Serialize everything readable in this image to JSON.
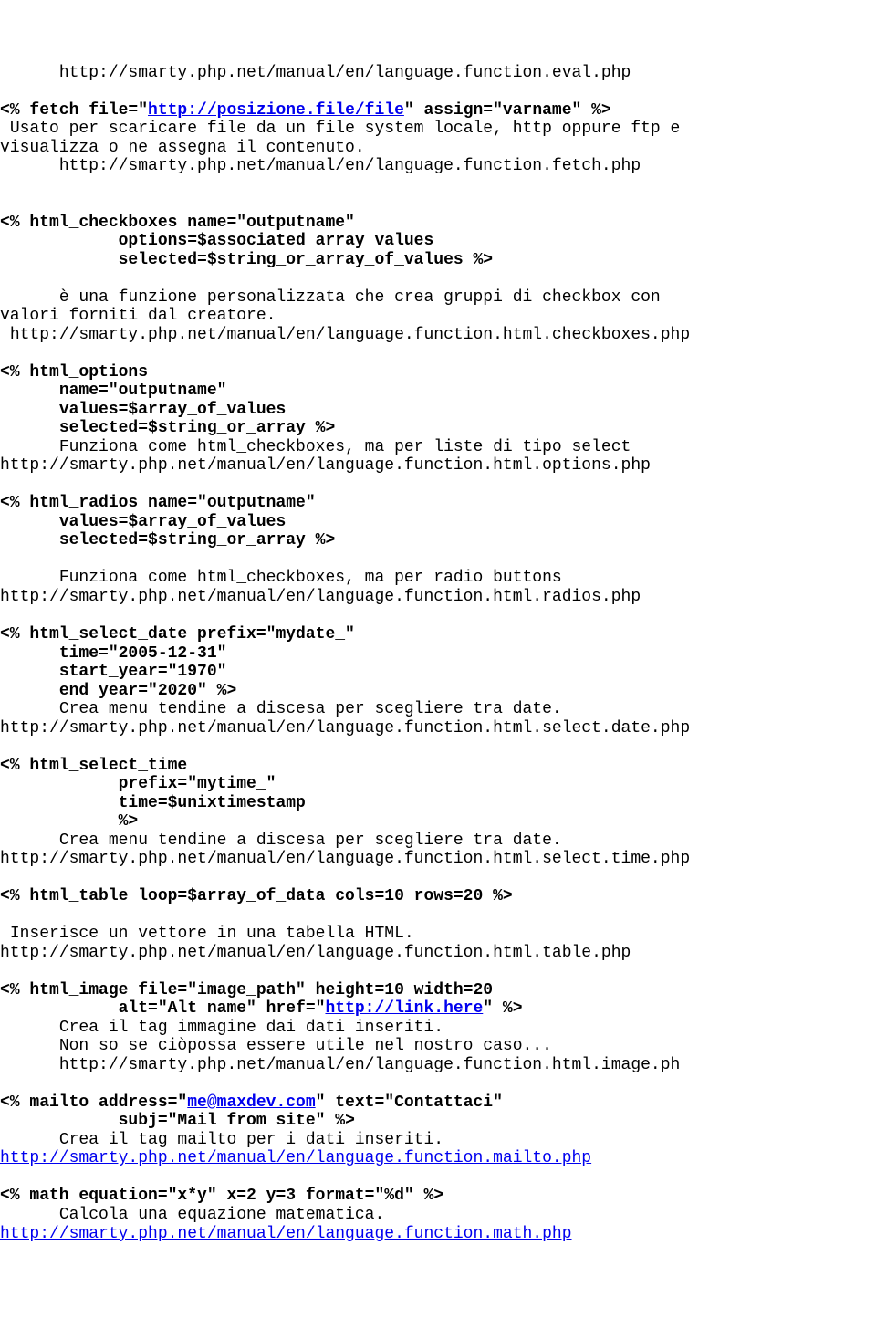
{
  "lines": [
    {
      "indent": 6,
      "parts": [
        {
          "t": "http://smarty.php.net/manual/en/language.function.eval.php"
        }
      ]
    },
    {
      "blank": true
    },
    {
      "indent": 0,
      "parts": [
        {
          "t": "<% fetch file=\"",
          "bold": true
        },
        {
          "t": "http://posizione.file/file",
          "bold": true,
          "link": true
        },
        {
          "t": "\" assign=\"varname\" %>",
          "bold": true
        }
      ]
    },
    {
      "indent": 1,
      "parts": [
        {
          "t": "Usato per scaricare file da un file system locale, http oppure ftp e"
        }
      ]
    },
    {
      "indent": 0,
      "parts": [
        {
          "t": "visualizza o ne assegna il contenuto."
        }
      ]
    },
    {
      "indent": 6,
      "parts": [
        {
          "t": "http://smarty.php.net/manual/en/language.function.fetch.php"
        }
      ]
    },
    {
      "blank": true
    },
    {
      "blank": true
    },
    {
      "indent": 0,
      "parts": [
        {
          "t": "<% html_checkboxes name=\"outputname\"",
          "bold": true
        }
      ]
    },
    {
      "indent": 12,
      "parts": [
        {
          "t": "options=$associated_array_values",
          "bold": true
        }
      ]
    },
    {
      "indent": 12,
      "parts": [
        {
          "t": "selected=$string_or_array_of_values %>",
          "bold": true
        }
      ]
    },
    {
      "blank": true
    },
    {
      "indent": 6,
      "parts": [
        {
          "t": "è una funzione personalizzata che crea gruppi di checkbox con"
        }
      ]
    },
    {
      "indent": 0,
      "parts": [
        {
          "t": "valori forniti dal creatore."
        }
      ]
    },
    {
      "indent": 1,
      "parts": [
        {
          "t": "http://smarty.php.net/manual/en/language.function.html.checkboxes.php"
        }
      ]
    },
    {
      "blank": true
    },
    {
      "indent": 0,
      "parts": [
        {
          "t": "<% html_options",
          "bold": true
        }
      ]
    },
    {
      "indent": 6,
      "parts": [
        {
          "t": "name=\"outputname\"",
          "bold": true
        }
      ]
    },
    {
      "indent": 6,
      "parts": [
        {
          "t": "values=$array_of_values",
          "bold": true
        }
      ]
    },
    {
      "indent": 6,
      "parts": [
        {
          "t": "selected=$string_or_array %>",
          "bold": true
        }
      ]
    },
    {
      "indent": 6,
      "parts": [
        {
          "t": "Funziona come html_checkboxes, ma per liste di tipo select"
        }
      ]
    },
    {
      "indent": 0,
      "parts": [
        {
          "t": "http://smarty.php.net/manual/en/language.function.html.options.php"
        }
      ]
    },
    {
      "blank": true
    },
    {
      "indent": 0,
      "parts": [
        {
          "t": "<% html_radios name=\"outputname\"",
          "bold": true
        }
      ]
    },
    {
      "indent": 6,
      "parts": [
        {
          "t": "values=$array_of_values",
          "bold": true
        }
      ]
    },
    {
      "indent": 6,
      "parts": [
        {
          "t": "selected=$string_or_array %>",
          "bold": true
        }
      ]
    },
    {
      "blank": true
    },
    {
      "indent": 6,
      "parts": [
        {
          "t": "Funziona come html_checkboxes, ma per radio buttons"
        }
      ]
    },
    {
      "indent": 0,
      "parts": [
        {
          "t": "http://smarty.php.net/manual/en/language.function.html.radios.php"
        }
      ]
    },
    {
      "blank": true
    },
    {
      "indent": 0,
      "parts": [
        {
          "t": "<% html_select_date prefix=\"mydate_\"",
          "bold": true
        }
      ]
    },
    {
      "indent": 6,
      "parts": [
        {
          "t": "time=\"2005-12-31\"",
          "bold": true
        }
      ]
    },
    {
      "indent": 6,
      "parts": [
        {
          "t": "start_year=\"1970\"",
          "bold": true
        }
      ]
    },
    {
      "indent": 6,
      "parts": [
        {
          "t": "end_year=\"2020\" %>",
          "bold": true
        }
      ]
    },
    {
      "indent": 6,
      "parts": [
        {
          "t": "Crea menu tendine a discesa per scegliere tra date."
        }
      ]
    },
    {
      "indent": 0,
      "parts": [
        {
          "t": "http://smarty.php.net/manual/en/language.function.html.select.date.php"
        }
      ]
    },
    {
      "blank": true
    },
    {
      "indent": 0,
      "parts": [
        {
          "t": "<% html_select_time",
          "bold": true
        }
      ]
    },
    {
      "indent": 12,
      "parts": [
        {
          "t": "prefix=\"mytime_\"",
          "bold": true
        }
      ]
    },
    {
      "indent": 12,
      "parts": [
        {
          "t": "time=$unixtimestamp",
          "bold": true
        }
      ]
    },
    {
      "indent": 12,
      "parts": [
        {
          "t": "%>",
          "bold": true
        }
      ]
    },
    {
      "indent": 6,
      "parts": [
        {
          "t": "Crea menu tendine a discesa per scegliere tra date."
        }
      ]
    },
    {
      "indent": 0,
      "parts": [
        {
          "t": "http://smarty.php.net/manual/en/language.function.html.select.time.php"
        }
      ]
    },
    {
      "blank": true
    },
    {
      "indent": 0,
      "parts": [
        {
          "t": "<% html_table loop=$array_of_data cols=10 rows=20 %>",
          "bold": true
        }
      ]
    },
    {
      "blank": true
    },
    {
      "indent": 1,
      "parts": [
        {
          "t": "Inserisce un vettore in una tabella HTML."
        }
      ]
    },
    {
      "indent": 0,
      "parts": [
        {
          "t": "http://smarty.php.net/manual/en/language.function.html.table.php"
        }
      ]
    },
    {
      "blank": true
    },
    {
      "indent": 0,
      "parts": [
        {
          "t": "<% html_image file=\"image_path\" height=10 width=20",
          "bold": true
        }
      ]
    },
    {
      "indent": 12,
      "parts": [
        {
          "t": "alt=\"Alt name\" href=\"",
          "bold": true
        },
        {
          "t": "http://link.here",
          "bold": true,
          "link": true
        },
        {
          "t": "\" %>",
          "bold": true
        }
      ]
    },
    {
      "indent": 6,
      "parts": [
        {
          "t": "Crea il tag immagine dai dati inseriti."
        }
      ]
    },
    {
      "indent": 6,
      "parts": [
        {
          "t": "Non so se ciòpossa essere utile nel nostro caso..."
        }
      ]
    },
    {
      "indent": 6,
      "parts": [
        {
          "t": "http://smarty.php.net/manual/en/language.function.html.image.ph"
        }
      ]
    },
    {
      "blank": true
    },
    {
      "indent": 0,
      "parts": [
        {
          "t": "<% mailto address=\"",
          "bold": true
        },
        {
          "t": "me@maxdev.com",
          "bold": true,
          "link": true
        },
        {
          "t": "\" text=\"Contattaci\"",
          "bold": true
        }
      ]
    },
    {
      "indent": 12,
      "parts": [
        {
          "t": "subj=\"Mail from site\" %>",
          "bold": true
        }
      ]
    },
    {
      "indent": 6,
      "parts": [
        {
          "t": "Crea il tag mailto per i dati inseriti."
        }
      ]
    },
    {
      "indent": 0,
      "parts": [
        {
          "t": "http://smarty.php.net/manual/en/language.function.mailto.php",
          "link": true
        }
      ]
    },
    {
      "blank": true
    },
    {
      "indent": 0,
      "parts": [
        {
          "t": "<% math equation=\"x*y\" x=2 y=3 format=\"%d\" %>",
          "bold": true
        }
      ]
    },
    {
      "indent": 6,
      "parts": [
        {
          "t": "Calcola una equazione matematica."
        }
      ]
    },
    {
      "indent": 0,
      "parts": [
        {
          "t": "http://smarty.php.net/manual/en/language.function.math.php",
          "link": true
        }
      ]
    }
  ]
}
